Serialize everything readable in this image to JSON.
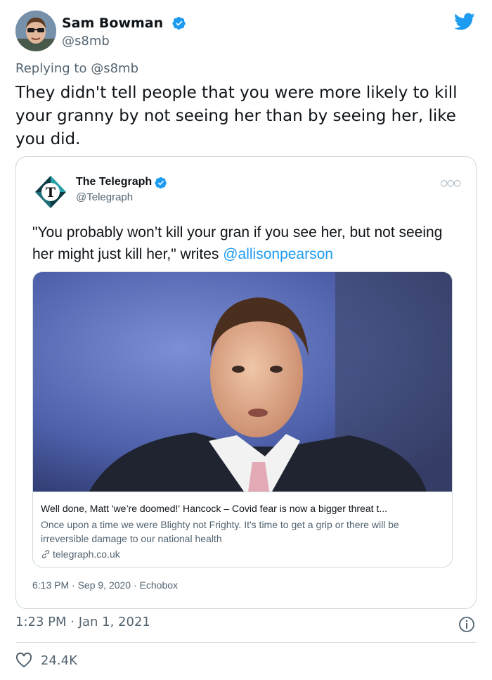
{
  "tweet": {
    "author_name": "Sam Bowman",
    "author_handle": "@s8mb",
    "replying_prefix": "Replying to",
    "replying_to": "@s8mb",
    "text": "They didn't tell people that you were more likely to kill your granny by not seeing her than by seeing her, like you did.",
    "time": "1:23 PM · Jan 1, 2021",
    "likes": "24.4K"
  },
  "quoted": {
    "author_name": "The Telegraph",
    "author_handle": "@Telegraph",
    "text": "\"You probably won’t kill your gran if you see her, but not seeing her might just kill her,\" writes",
    "mention": "@allisonpearson",
    "card": {
      "title": "Well done, Matt 'we’re doomed!' Hancock – Covid fear is now a bigger threat t...",
      "description": "Once upon a time we were Blighty not Frighty. It's time to get a grip or there will be irreversible damage to our national health",
      "domain": "telegraph.co.uk"
    },
    "meta": "6:13 PM · Sep 9, 2020 · Echobox"
  },
  "icons": {
    "verified": "verified-badge-icon",
    "brand": "twitter-bird-icon",
    "more": "more-icon",
    "link": "link-icon",
    "info": "info-icon",
    "like": "heart-icon"
  },
  "colors": {
    "accent": "#1d9bf0",
    "secondary_text": "#536471",
    "border": "#cfd9de"
  }
}
